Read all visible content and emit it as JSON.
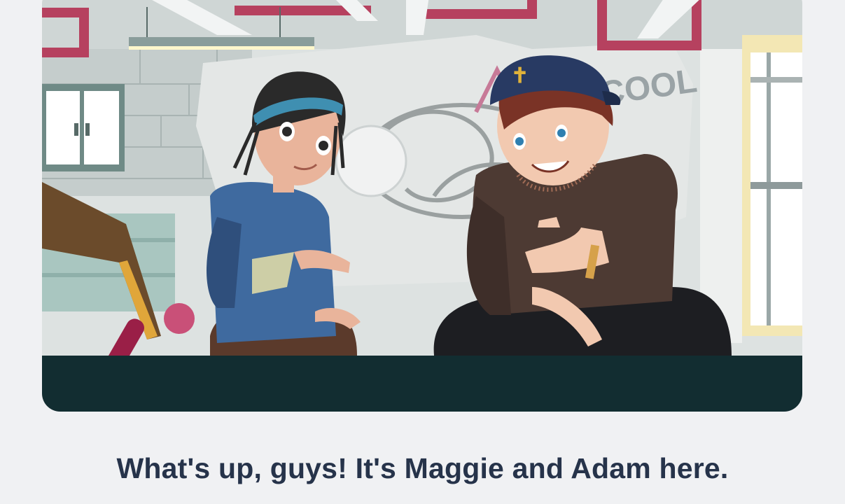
{
  "scene": {
    "characters": [
      "girl-with-headband",
      "guy-with-backwards-cap"
    ],
    "graffiti_text": "COOL",
    "colors": {
      "background": "#f0f1f3",
      "caption": "#26334a",
      "floor": "#122d31",
      "pipes": "#b6415f",
      "maggie_hoodie": "#3f6a9f",
      "adam_shirt": "#4d3a33"
    }
  },
  "caption": {
    "text": "What's up, guys! It's Maggie and Adam here."
  }
}
